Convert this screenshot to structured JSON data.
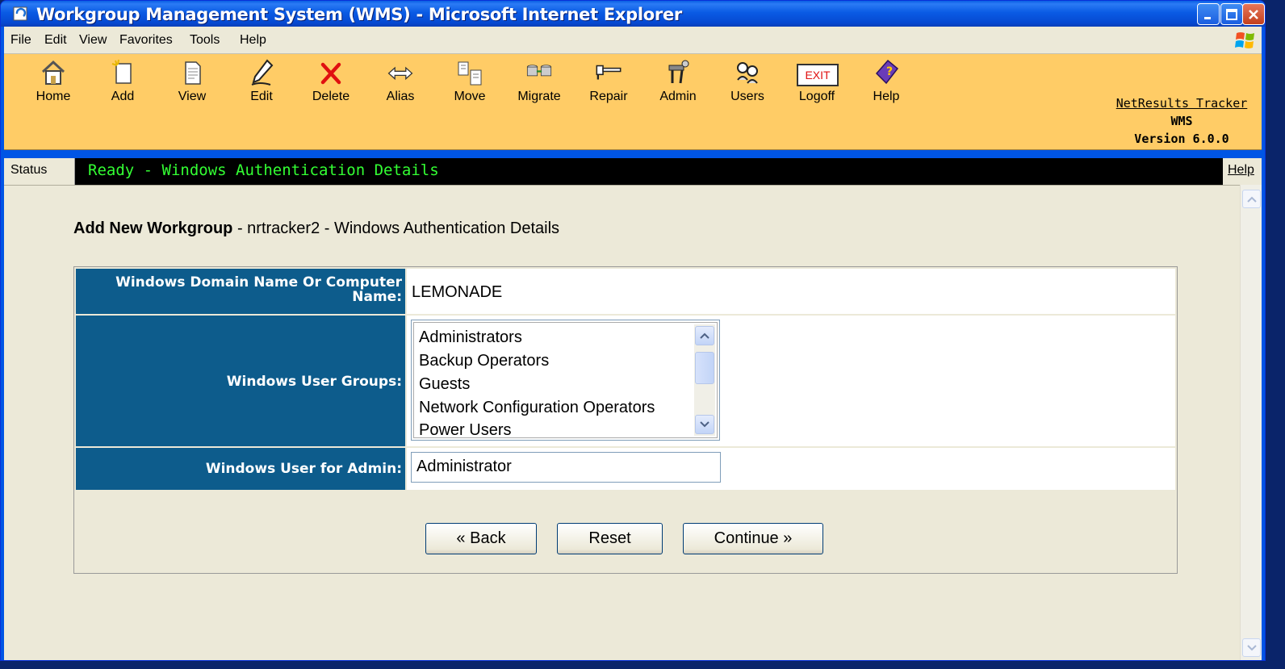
{
  "window": {
    "title": "Workgroup Management System (WMS) - Microsoft Internet Explorer"
  },
  "menu": [
    "File",
    "Edit",
    "View",
    "Favorites",
    "Tools",
    "Help"
  ],
  "toolbar": {
    "buttons": [
      "Home",
      "Add",
      "View",
      "Edit",
      "Delete",
      "Alias",
      "Move",
      "Migrate",
      "Repair",
      "Admin",
      "Users",
      "Logoff",
      "Help"
    ],
    "exit_badge": "EXIT"
  },
  "brand": {
    "product": "NetResults Tracker",
    "module": "WMS",
    "version": "Version 6.0.0"
  },
  "status": {
    "label": "Status",
    "text": "Ready - Windows Authentication Details",
    "help": "Help"
  },
  "page": {
    "heading_bold": "Add New Workgroup",
    "heading_rest": " - nrtracker2 - Windows Authentication Details"
  },
  "form": {
    "domain_label_line1": "Windows Domain Name Or Computer",
    "domain_label_line2": "Name:",
    "domain_value": "LEMONADE",
    "groups_label": "Windows User Groups:",
    "groups_options": [
      "Administrators",
      "Backup Operators",
      "Guests",
      "Network Configuration Operators",
      "Power Users"
    ],
    "admin_label": "Windows User for Admin:",
    "admin_value": "Administrator"
  },
  "actions": {
    "back": "« Back",
    "reset": "Reset",
    "continue": "Continue »"
  }
}
